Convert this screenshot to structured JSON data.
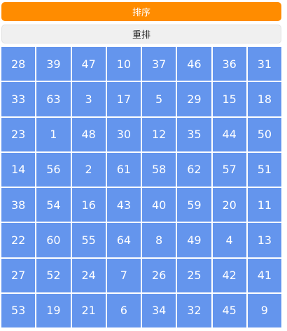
{
  "controls": {
    "sort_label": "排序",
    "reset_label": "重排"
  },
  "colors": {
    "accent": "#ff8c00",
    "tile": "#6495ed",
    "tile_text": "#ffffff"
  },
  "grid": {
    "rows": [
      [
        28,
        39,
        47,
        10,
        37,
        46,
        36,
        31
      ],
      [
        33,
        63,
        3,
        17,
        5,
        29,
        15,
        18
      ],
      [
        23,
        1,
        48,
        30,
        12,
        35,
        44,
        50
      ],
      [
        14,
        56,
        2,
        61,
        58,
        62,
        57,
        51
      ],
      [
        38,
        54,
        16,
        43,
        40,
        59,
        20,
        11
      ],
      [
        22,
        60,
        55,
        64,
        8,
        49,
        4,
        13
      ],
      [
        27,
        52,
        24,
        7,
        26,
        25,
        42,
        41
      ],
      [
        53,
        19,
        21,
        6,
        34,
        32,
        45,
        9
      ]
    ]
  }
}
